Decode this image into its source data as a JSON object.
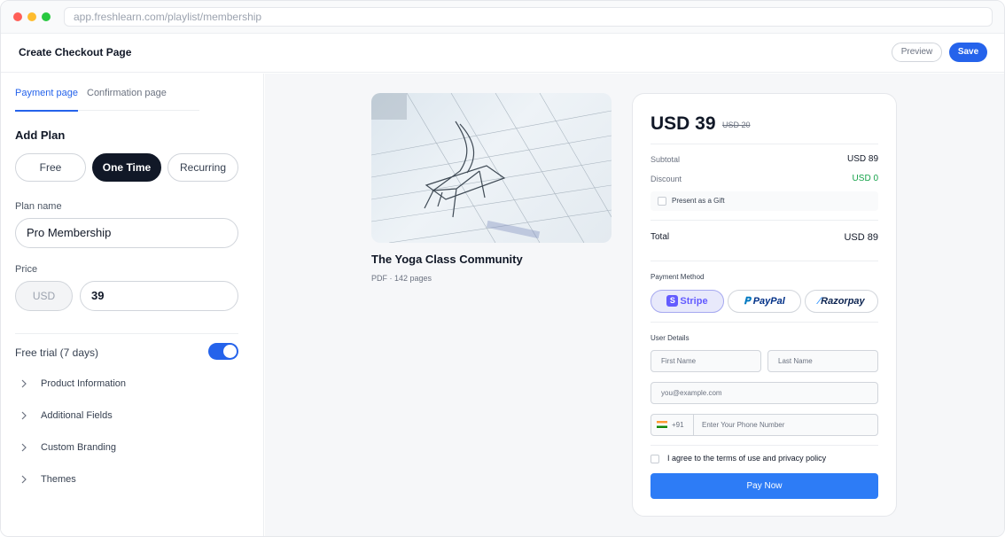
{
  "browser": {
    "url": "app.freshlearn.com/playlist/membership"
  },
  "header": {
    "title": "Create Checkout Page",
    "preview_label": "Preview",
    "save_label": "Save"
  },
  "sidebar": {
    "tabs": [
      {
        "label": "Payment page",
        "active": true
      },
      {
        "label": "Confirmation page",
        "active": false
      }
    ],
    "add_plan_title": "Add Plan",
    "plan_types": [
      {
        "label": "Free",
        "selected": false
      },
      {
        "label": "One Time",
        "selected": true
      },
      {
        "label": "Recurring",
        "selected": false
      }
    ],
    "plan_name_label": "Plan name",
    "plan_name_value": "Pro Membership",
    "price_label": "Price",
    "price_currency": "USD",
    "price_value": "39",
    "free_trial_label": "Free trial (7 days)",
    "free_trial_enabled": true,
    "sections": [
      {
        "label": "Product Information"
      },
      {
        "label": "Additional Fields"
      },
      {
        "label": "Custom Branding"
      },
      {
        "label": "Themes"
      }
    ]
  },
  "product": {
    "title": "The Yoga Class Community",
    "meta": "PDF · 142 pages"
  },
  "checkout": {
    "price": "USD 39",
    "old_price": "USD 20",
    "subtotal_label": "Subtotal",
    "subtotal_value": "USD 89",
    "discount_label": "Discount",
    "discount_value": "USD 0",
    "gift_label": "Present as a Gift",
    "total_label": "Total",
    "total_value": "USD 89",
    "payment_method_label": "Payment Method",
    "payment_methods": [
      {
        "label": "Stripe",
        "selected": true
      },
      {
        "label": "PayPal",
        "selected": false
      },
      {
        "label": "Razorpay",
        "selected": false
      }
    ],
    "user_details_label": "User Details",
    "first_name_placeholder": "First Name",
    "last_name_placeholder": "Last Name",
    "email_placeholder": "you@example.com",
    "phone_code": "+91",
    "phone_placeholder": "Enter Your Phone Number",
    "terms_label": "I agree to the terms of use and privacy policy",
    "pay_button_label": "Pay Now"
  },
  "colors": {
    "accent": "#2563eb",
    "pay_button": "#2d7cf6",
    "discount_green": "#16a34a",
    "stripe": "#635bff",
    "dark_button": "#111827"
  }
}
